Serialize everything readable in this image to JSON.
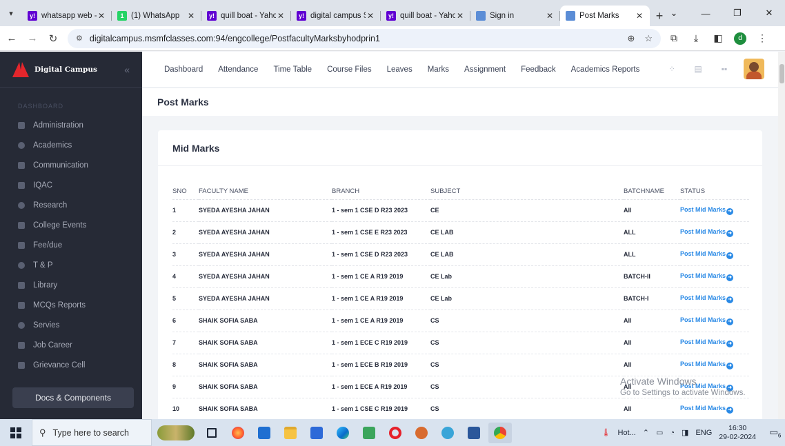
{
  "browser": {
    "tabs": [
      {
        "title": "whatsapp web -",
        "favicon": "yahoo-icon",
        "color": "#6001d2",
        "fav_letter": "y!"
      },
      {
        "title": "(1) WhatsApp",
        "favicon": "whatsapp-icon",
        "color": "#25d366",
        "fav_letter": "1"
      },
      {
        "title": "quill boat - Yaho",
        "favicon": "yahoo-icon",
        "color": "#6001d2",
        "fav_letter": "y!"
      },
      {
        "title": "digital campus S",
        "favicon": "yahoo-icon",
        "color": "#6001d2",
        "fav_letter": "y!"
      },
      {
        "title": "quill boat - Yaho",
        "favicon": "yahoo-icon",
        "color": "#6001d2",
        "fav_letter": "y!"
      },
      {
        "title": "Sign in",
        "favicon": "site-icon",
        "color": "#5b8dd6",
        "fav_letter": ""
      },
      {
        "title": "Post Marks",
        "favicon": "site-icon",
        "color": "#5b8dd6",
        "fav_letter": "",
        "active": true
      }
    ],
    "url": "digitalcampus.msmfclasses.com:94/engcollege/PostfacultyMarksbyhodprin1",
    "profile_letter": "d"
  },
  "sidebar": {
    "brand": "Digital Campus",
    "section": "DASHBOARD",
    "items": [
      {
        "label": "Administration",
        "icon": "grid-icon"
      },
      {
        "label": "Academics",
        "icon": "chart-icon"
      },
      {
        "label": "Communication",
        "icon": "graduation-cap-icon"
      },
      {
        "label": "IQAC",
        "icon": "monitor-icon"
      },
      {
        "label": "Research",
        "icon": "gear-icon"
      },
      {
        "label": "College Events",
        "icon": "gear-icon"
      },
      {
        "label": "Fee/due",
        "icon": "person-icon"
      },
      {
        "label": "T & P",
        "icon": "grid-icon"
      },
      {
        "label": "Library",
        "icon": "people-icon"
      },
      {
        "label": "MCQs Reports",
        "icon": "people-icon"
      },
      {
        "label": "Servies",
        "icon": "person-icon"
      },
      {
        "label": "Job Career",
        "icon": "globe-icon"
      },
      {
        "label": "Grievance Cell",
        "icon": "people-icon"
      }
    ],
    "docs_button": "Docs & Components"
  },
  "topnav": {
    "items": [
      "Dashboard",
      "Attendance",
      "Time Table",
      "Course Files",
      "Leaves",
      "Marks",
      "Assignment",
      "Feedback",
      "Academics Reports"
    ]
  },
  "page_title": "Post Marks",
  "card": {
    "title": "Mid Marks",
    "columns": [
      "SNO",
      "FACULTY NAME",
      "BRANCH",
      "SUBJECT",
      "BATCHNAME",
      "STATUS"
    ],
    "rows": [
      {
        "sno": "1",
        "faculty": "SYEDA AYESHA JAHAN",
        "branch": "1 - sem 1 CSE D R23 2023",
        "subject": "CE",
        "batch": "All",
        "status": "Post Mid Marks"
      },
      {
        "sno": "2",
        "faculty": "SYEDA AYESHA JAHAN",
        "branch": "1 - sem 1 CSE E R23 2023",
        "subject": "CE LAB",
        "batch": "ALL",
        "status": "Post Mid Marks"
      },
      {
        "sno": "3",
        "faculty": "SYEDA AYESHA JAHAN",
        "branch": "1 - sem 1 CSE D R23 2023",
        "subject": "CE LAB",
        "batch": "ALL",
        "status": "Post Mid Marks"
      },
      {
        "sno": "4",
        "faculty": "SYEDA AYESHA JAHAN",
        "branch": "1 - sem 1 CE A R19 2019",
        "subject": "CE Lab",
        "batch": "BATCH-II",
        "status": "Post Mid Marks"
      },
      {
        "sno": "5",
        "faculty": "SYEDA AYESHA JAHAN",
        "branch": "1 - sem 1 CE A R19 2019",
        "subject": "CE Lab",
        "batch": "BATCH-I",
        "status": "Post Mid Marks"
      },
      {
        "sno": "6",
        "faculty": "SHAIK SOFIA SABA",
        "branch": "1 - sem 1 CE A R19 2019",
        "subject": "CS",
        "batch": "All",
        "status": "Post Mid Marks"
      },
      {
        "sno": "7",
        "faculty": "SHAIK SOFIA SABA",
        "branch": "1 - sem 1 ECE C R19 2019",
        "subject": "CS",
        "batch": "All",
        "status": "Post Mid Marks"
      },
      {
        "sno": "8",
        "faculty": "SHAIK SOFIA SABA",
        "branch": "1 - sem 1 ECE B R19 2019",
        "subject": "CS",
        "batch": "All",
        "status": "Post Mid Marks"
      },
      {
        "sno": "9",
        "faculty": "SHAIK SOFIA SABA",
        "branch": "1 - sem 1 ECE A R19 2019",
        "subject": "CS",
        "batch": "All",
        "status": "Post Mid Marks"
      },
      {
        "sno": "10",
        "faculty": "SHAIK SOFIA SABA",
        "branch": "1 - sem 1 CSE C R19 2019",
        "subject": "CS",
        "batch": "All",
        "status": "Post Mid Marks"
      }
    ]
  },
  "watermark": {
    "line1": "Activate Windows",
    "line2": "Go to Settings to activate Windows."
  },
  "taskbar": {
    "search_placeholder": "Type here to search",
    "weather": "Hot...",
    "language": "ENG",
    "time": "16:30",
    "date": "29-02-2024",
    "notification_count": "6"
  },
  "colors": {
    "accent": "#2a8ae6",
    "sidebar_bg": "#262a36",
    "brand_red": "#e4262c"
  }
}
